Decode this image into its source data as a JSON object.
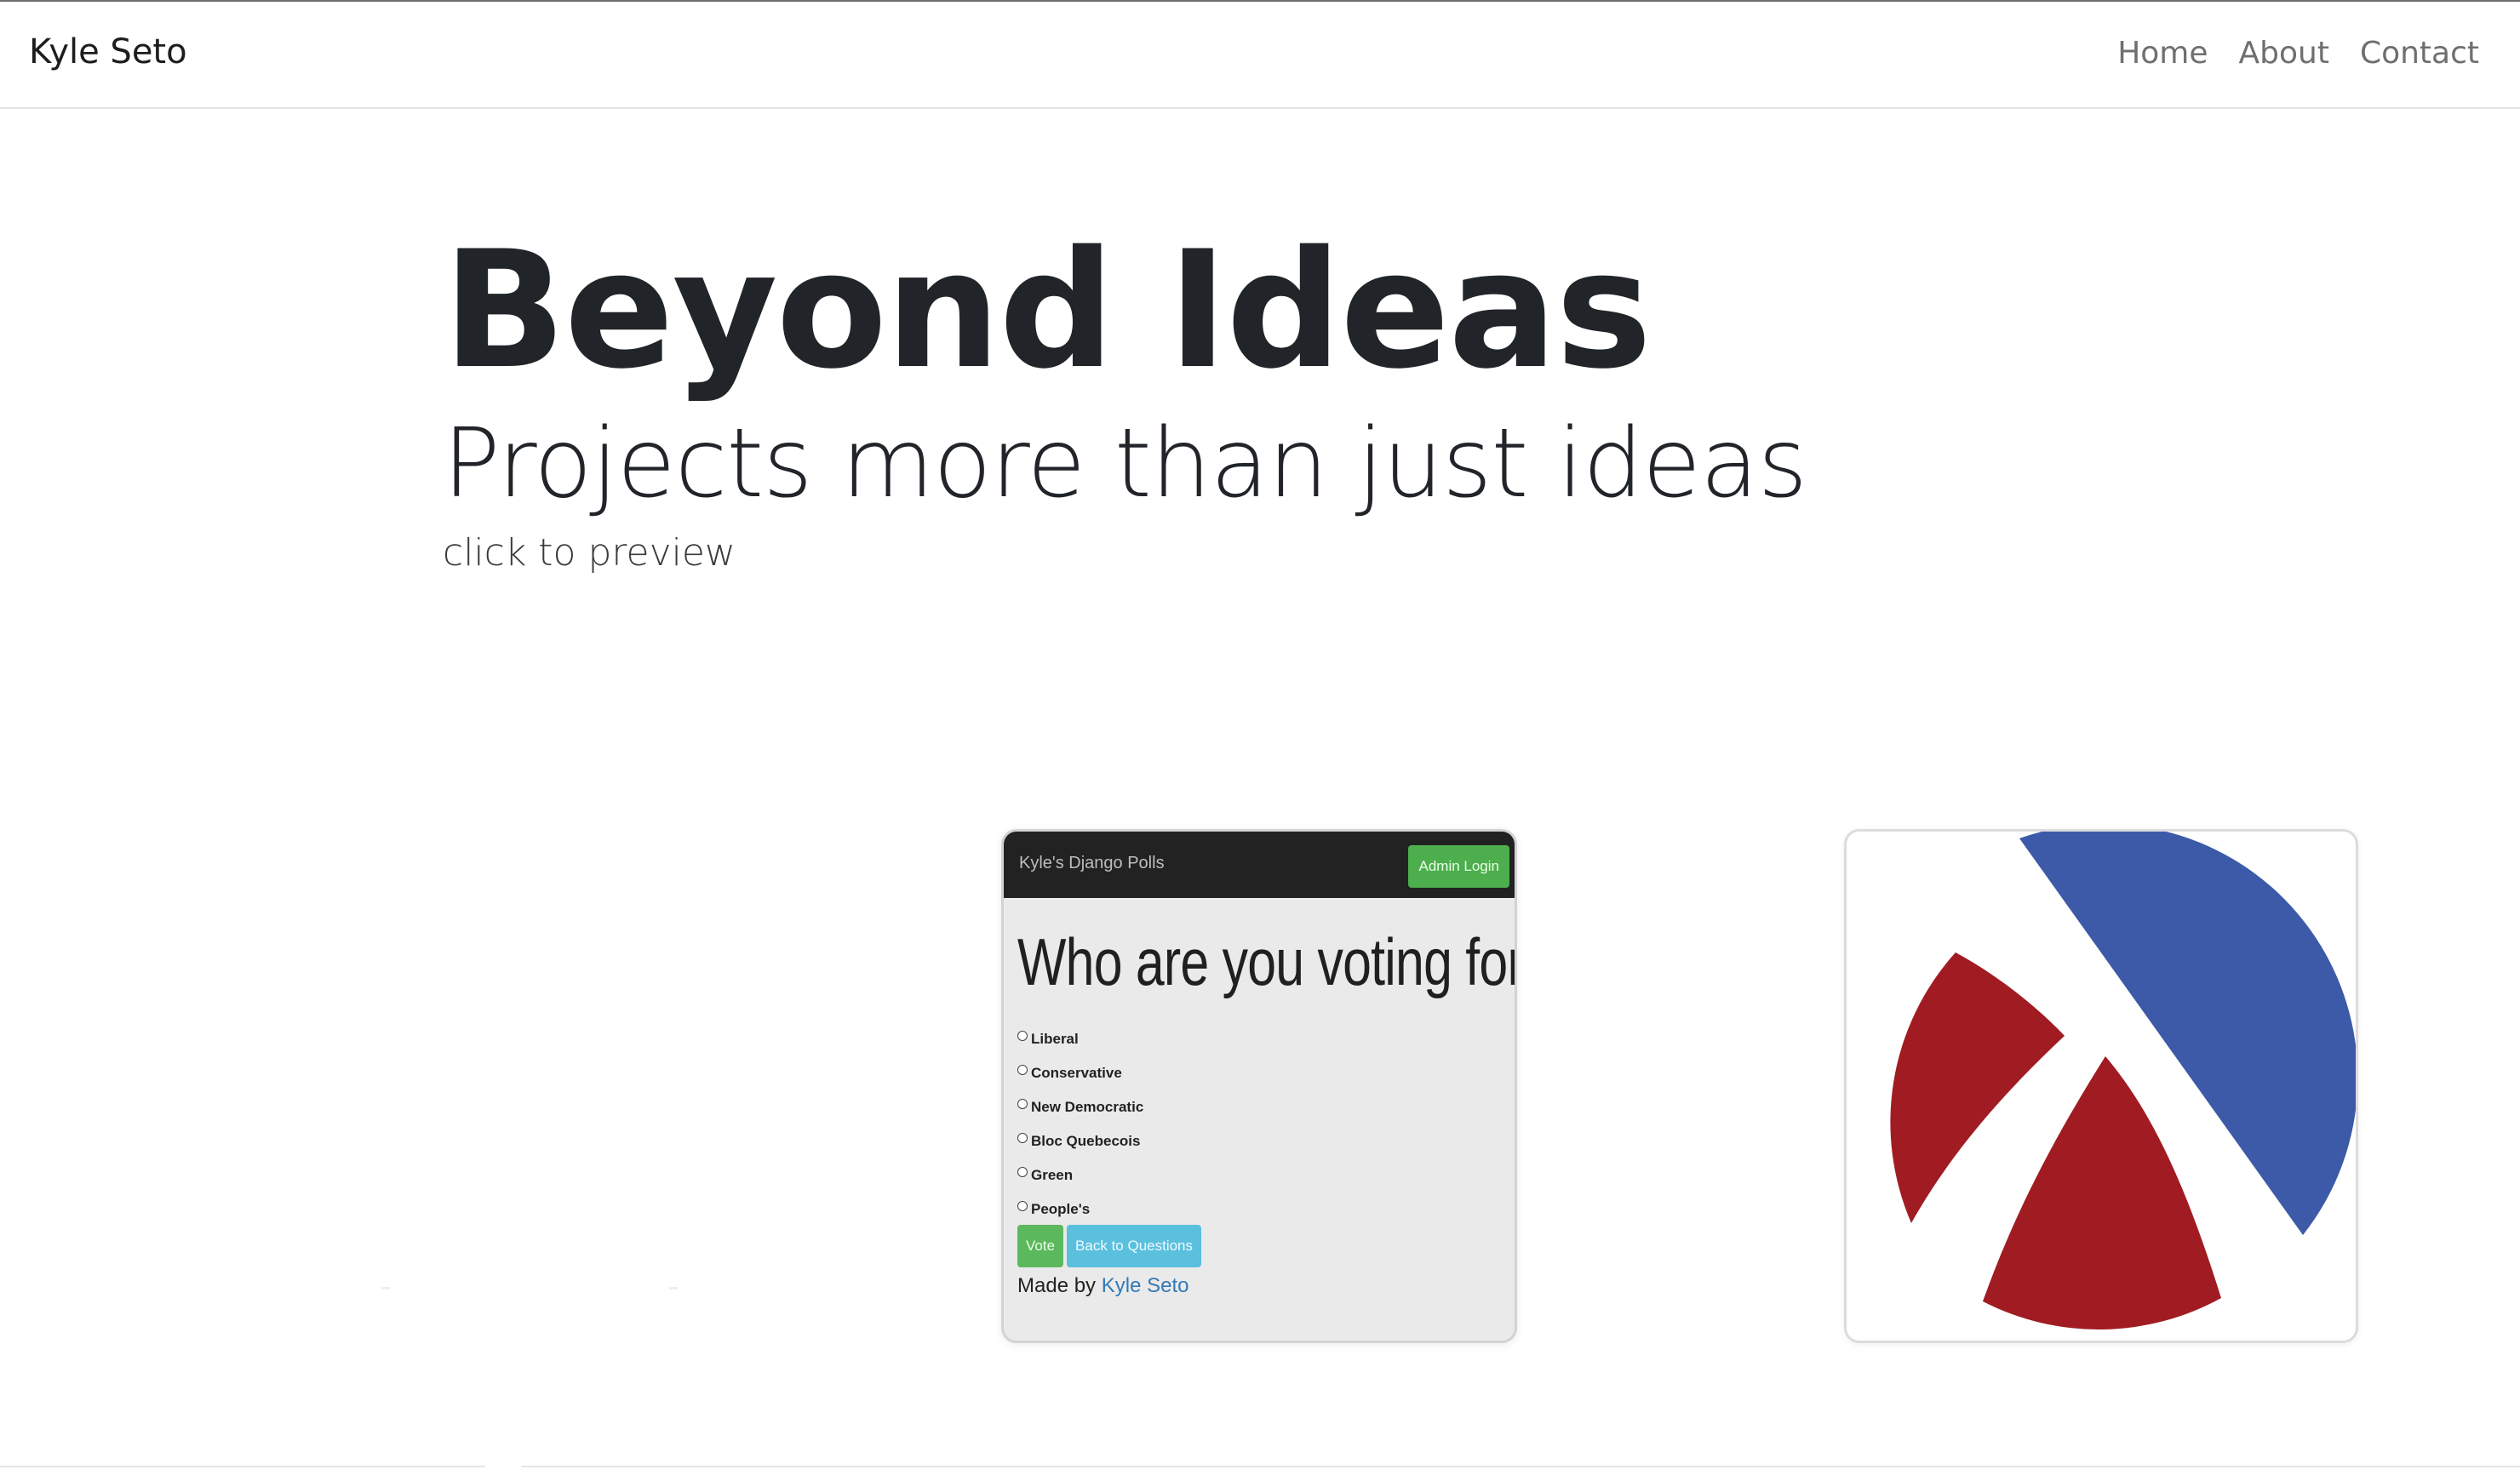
{
  "navbar": {
    "brand": "Kyle Seto",
    "links": [
      "Home",
      "About",
      "Contact"
    ]
  },
  "hero": {
    "title": "Beyond Ideas",
    "subtitle": "Projects more than just ideas",
    "hint": "click to preview"
  },
  "projects": {
    "polls": {
      "app_name": "Kyle's Django Polls",
      "admin_button": "Admin Login",
      "question": "Who are you voting for?",
      "options": [
        "Liberal",
        "Conservative",
        "New Democratic",
        "Bloc Quebecois",
        "Green",
        "People's"
      ],
      "vote_button": "Vote",
      "back_button": "Back to Questions",
      "footer_prefix": "Made by",
      "footer_link": "Kyle Seto"
    },
    "racket": {
      "icon": "racket-logo-icon",
      "colors": {
        "red": "#a01c22",
        "blue": "#3d5aa8"
      }
    }
  },
  "colors": {
    "text": "#212529",
    "nav_link": "#6f6f6f",
    "border": "#e3e3e3"
  }
}
